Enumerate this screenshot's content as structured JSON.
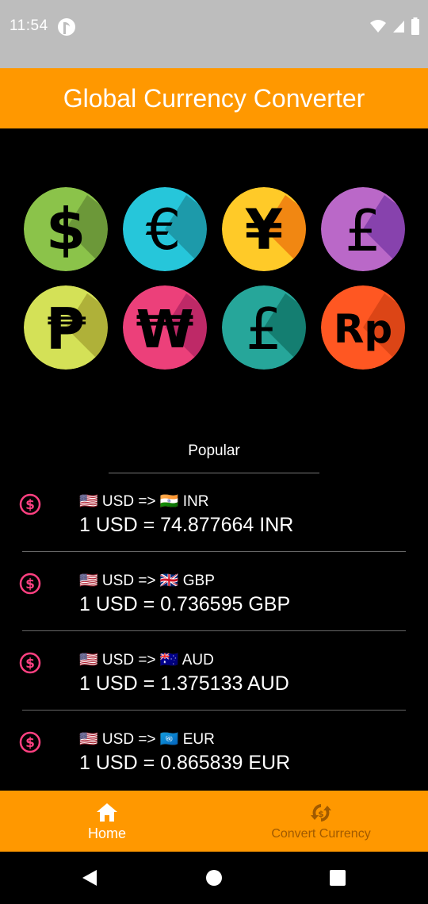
{
  "status_bar": {
    "time": "11:54",
    "icons": [
      "app-notification-icon",
      "wifi-icon",
      "signal-icon",
      "battery-icon"
    ]
  },
  "app_bar": {
    "title": "Global Currency Converter",
    "color": "#ff9800"
  },
  "currency_icons": [
    {
      "symbol": "$",
      "name": "dollar",
      "color": "#8bc34a"
    },
    {
      "symbol": "€",
      "name": "euro",
      "color": "#26c6da"
    },
    {
      "symbol": "¥",
      "name": "yen",
      "color": "#ffca28"
    },
    {
      "symbol": "£",
      "name": "pound",
      "color": "#ba68c8"
    },
    {
      "symbol": "₱",
      "name": "peso",
      "color": "#d4e157"
    },
    {
      "symbol": "₩",
      "name": "won",
      "color": "#ec407a"
    },
    {
      "symbol": "£",
      "name": "lira",
      "color": "#26a69a"
    },
    {
      "symbol": "Rp",
      "name": "rupiah",
      "color": "#ff5722"
    }
  ],
  "popular": {
    "title": "Popular",
    "items": [
      {
        "pair": "🇺🇸 USD => 🇮🇳 INR",
        "value": "1 USD = 74.877664 INR"
      },
      {
        "pair": "🇺🇸 USD => 🇬🇧 GBP",
        "value": "1 USD = 0.736595 GBP"
      },
      {
        "pair": "🇺🇸 USD => 🇦🇺 AUD",
        "value": "1 USD = 1.375133 AUD"
      },
      {
        "pair": "🇺🇸 USD => 🇺🇳 EUR",
        "value": "1 USD = 0.865839 EUR"
      }
    ]
  },
  "bottom_nav": {
    "items": [
      {
        "label": "Home",
        "icon": "home-icon",
        "active": true
      },
      {
        "label": "Convert Currency",
        "icon": "convert-icon",
        "active": false
      }
    ]
  },
  "system_nav": {
    "buttons": [
      "back-icon",
      "home-circle-icon",
      "recents-icon"
    ]
  }
}
